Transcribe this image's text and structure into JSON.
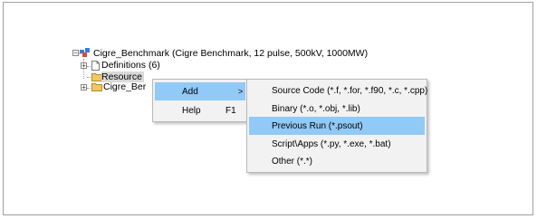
{
  "tree": {
    "root_label": "Cigre_Benchmark (Cigre Benchmark, 12 pulse, 500kV, 1000MW)",
    "definitions_label": "Definitions (6)",
    "resources_label": "Resource",
    "cigre_folder_label": "Cigre_Ber"
  },
  "context_menu": {
    "items": [
      {
        "label": "Add",
        "shortcut": "",
        "arrow": ">"
      },
      {
        "label": "Help",
        "shortcut": "F1",
        "arrow": ""
      }
    ]
  },
  "submenu": {
    "items": [
      {
        "label": "Source Code (*.f, *.for, *.f90, *.c, *.cpp)"
      },
      {
        "label": "Binary (*.o, *.obj, *.lib)"
      },
      {
        "label": "Previous Run (*.psout)"
      },
      {
        "label": "Script\\Apps (*.py, *.exe, *.bat)"
      },
      {
        "label": "Other (*.*)"
      }
    ],
    "highlighted_index": 2
  },
  "colors": {
    "menu_highlight": "#91c9f7",
    "menu_background": "#f2f2f2",
    "selection_background": "#d9d9d9"
  }
}
